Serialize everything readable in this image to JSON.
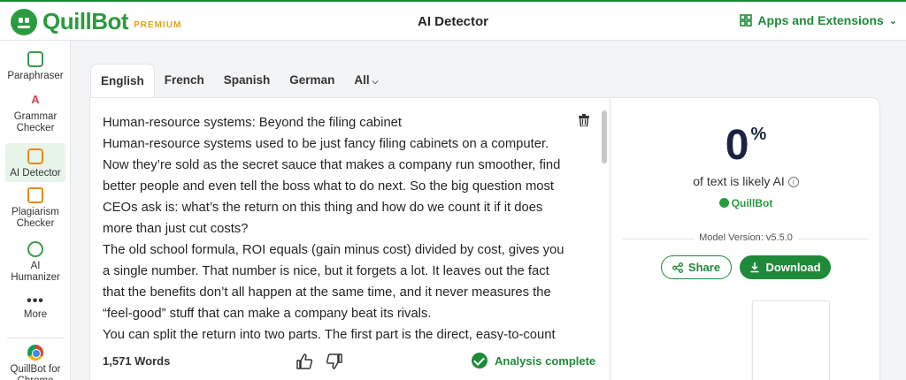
{
  "header": {
    "brand": "QuillBot",
    "brand_tier": "PREMIUM",
    "title": "AI Detector",
    "apps_label": "Apps and Extensions",
    "brand_color": "#2a9b3e"
  },
  "sidebar": {
    "items": [
      {
        "label": "Paraphraser",
        "icon": "paraphraser-icon"
      },
      {
        "label": "Grammar Checker",
        "icon": "grammar-icon"
      },
      {
        "label": "AI Detector",
        "icon": "ai-detector-icon",
        "active": true
      },
      {
        "label": "Plagiarism Checker",
        "icon": "plagiarism-icon"
      },
      {
        "label": "AI Humanizer",
        "icon": "humanizer-icon"
      },
      {
        "label": "More",
        "icon": "more-icon"
      },
      {
        "label": "QuillBot for Chrome",
        "icon": "chrome-icon"
      }
    ]
  },
  "language_tabs": [
    {
      "label": "English",
      "active": true
    },
    {
      "label": "French"
    },
    {
      "label": "Spanish"
    },
    {
      "label": "German"
    },
    {
      "label": "All"
    }
  ],
  "editor": {
    "paragraphs": [
      "Human-resource systems: Beyond the filing cabinet",
      "Human-resource systems used to be just fancy filing cabinets on a computer. Now they’re sold as the secret sauce that makes a company run smoother, find better people and even tell the boss what to do next. So the big question most CEOs ask is: what’s the return on this thing and how do we count it if it does more than just cut costs?",
      "The old school formula, ROI equals (gain minus cost) divided by cost, gives you a single number. That number is nice, but it forgets a lot. It leaves out the fact that the benefits don’t all happen at the same time, and it never measures the “feel-good” stuff that can make a company beat its rivals.",
      "You can split the return into two parts. The first part is the direct, easy-to-count"
    ],
    "word_count": "1,571 Words",
    "status": "Analysis complete"
  },
  "result": {
    "score": "0",
    "score_unit": "%",
    "caption": "of text is likely AI",
    "badge": "QuillBot",
    "model_version": "Model Version: v5.5.0",
    "share_label": "Share",
    "download_label": "Download",
    "accent_color": "#1f8a3a"
  }
}
